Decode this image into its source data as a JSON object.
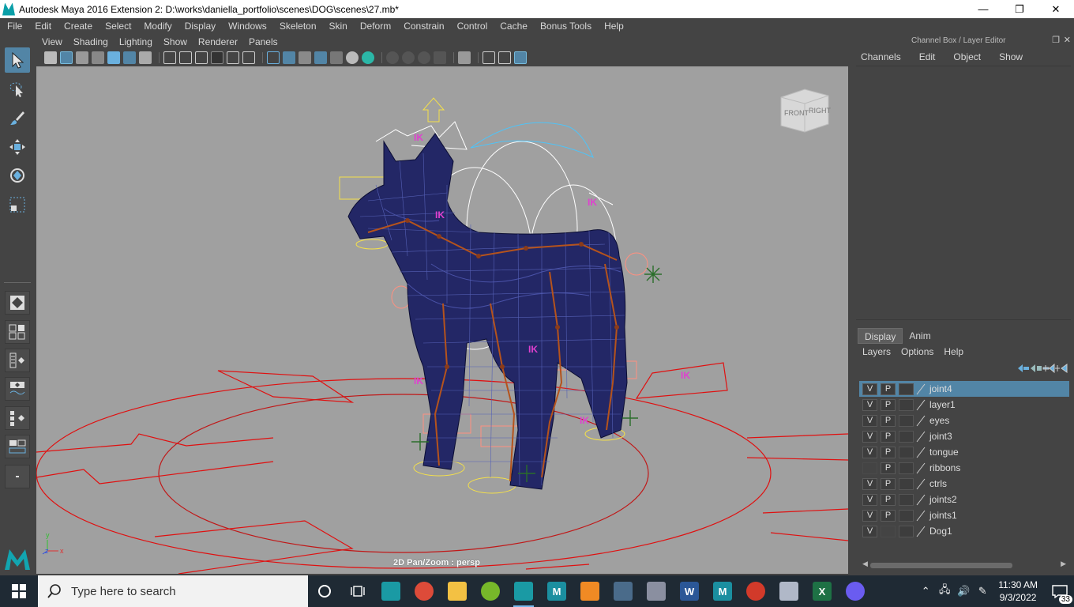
{
  "window": {
    "title": "Autodesk Maya 2016 Extension 2: D:\\works\\daniella_portfolio\\scenes\\DOG\\scenes\\27.mb*",
    "minimize": "—",
    "maximize": "❐",
    "close": "✕"
  },
  "main_menu": [
    "File",
    "Edit",
    "Create",
    "Select",
    "Modify",
    "Display",
    "Windows",
    "Skeleton",
    "Skin",
    "Deform",
    "Constrain",
    "Control",
    "Cache",
    "Bonus Tools",
    "Help"
  ],
  "panel_menu": [
    "View",
    "Shading",
    "Lighting",
    "Show",
    "Renderer",
    "Panels"
  ],
  "viewport": {
    "hud_text": "2D Pan/Zoom : persp",
    "viewcube_front": "FRONT",
    "viewcube_right": "RIGHT",
    "axis_labels": {
      "x": "x",
      "y": "y",
      "z": "z"
    },
    "background": "#a0a0a0",
    "ground_color": "#e01010",
    "mesh_color": "#1c1f6e"
  },
  "channel_box": {
    "title": "Channel Box / Layer Editor",
    "menu": [
      "Channels",
      "Edit",
      "Object",
      "Show"
    ]
  },
  "layer_editor": {
    "tabs": [
      "Display",
      "Anim"
    ],
    "active_tab": "Display",
    "menu": [
      "Layers",
      "Options",
      "Help"
    ],
    "layers": [
      {
        "v": "V",
        "p": "P",
        "name": "joint4",
        "selected": true
      },
      {
        "v": "V",
        "p": "P",
        "name": "layer1",
        "selected": false
      },
      {
        "v": "V",
        "p": "P",
        "name": "eyes",
        "selected": false
      },
      {
        "v": "V",
        "p": "P",
        "name": "joint3",
        "selected": false
      },
      {
        "v": "V",
        "p": "P",
        "name": "tongue",
        "selected": false
      },
      {
        "v": "",
        "p": "P",
        "name": "ribbons",
        "selected": false
      },
      {
        "v": "V",
        "p": "P",
        "name": "ctrls",
        "selected": false
      },
      {
        "v": "V",
        "p": "P",
        "name": "joints2",
        "selected": false
      },
      {
        "v": "V",
        "p": "P",
        "name": "joints1",
        "selected": false
      },
      {
        "v": "V",
        "p": "",
        "name": "Dog1",
        "selected": false
      }
    ]
  },
  "taskbar": {
    "search_placeholder": "Type here to search",
    "time": "11:30 AM",
    "date": "9/3/2022",
    "notifications": "33",
    "apps": [
      {
        "icon": "maya-icon",
        "label": "",
        "color": "#1a9aa4",
        "running": false
      },
      {
        "icon": "chrome-icon",
        "label": "",
        "color": "#dd4b39",
        "running": false
      },
      {
        "icon": "file-explorer-icon",
        "label": "",
        "color": "#f3c143",
        "running": false
      },
      {
        "icon": "utorrent-icon",
        "label": "",
        "color": "#77b82a",
        "running": false
      },
      {
        "icon": "maya-icon",
        "label": "",
        "color": "#1a9aa4",
        "running": true
      },
      {
        "icon": "mudbox-icon",
        "label": "M",
        "color": "#1b8fa0",
        "running": false
      },
      {
        "icon": "vlc-icon",
        "label": "",
        "color": "#f08a24",
        "running": false
      },
      {
        "icon": "calculator-icon",
        "label": "",
        "color": "#4a6b8a",
        "running": false
      },
      {
        "icon": "network-icon",
        "label": "",
        "color": "#8a8fa0",
        "running": false
      },
      {
        "icon": "word-icon",
        "label": "W",
        "color": "#2b5797",
        "running": false
      },
      {
        "icon": "mudbox-icon",
        "label": "M",
        "color": "#1b8fa0",
        "running": false
      },
      {
        "icon": "record-icon",
        "label": "",
        "color": "#d23a2a",
        "running": false
      },
      {
        "icon": "paint-icon",
        "label": "",
        "color": "#b0b8c8",
        "running": false
      },
      {
        "icon": "excel-icon",
        "label": "X",
        "color": "#1e7145",
        "running": false
      },
      {
        "icon": "messenger-icon",
        "label": "",
        "color": "#6a5cf0",
        "running": false
      }
    ]
  }
}
